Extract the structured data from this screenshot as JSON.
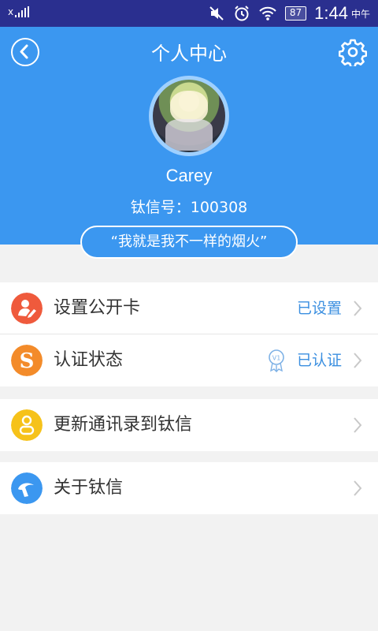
{
  "status_bar": {
    "network_label": "x",
    "battery": "87",
    "time": "1:44",
    "period": "中午"
  },
  "header": {
    "title": "个人中心",
    "username": "Carey",
    "user_id": "钛信号：100308",
    "signature": "“我就是我不一样的烟火”",
    "accent": "#3b97f0"
  },
  "menu": {
    "public_card": {
      "label": "设置公开卡",
      "value": "已设置",
      "icon": "person-card-icon",
      "color": "#ef5a3c"
    },
    "verify": {
      "label": "认证状态",
      "value": "已认证",
      "badge": "V1",
      "icon": "s-logo-icon",
      "color": "#f38b2a"
    },
    "contacts": {
      "label": "更新通讯录到钛信",
      "icon": "contact-person-icon",
      "color": "#f6c21a"
    },
    "about": {
      "label": "关于钛信",
      "icon": "app-logo-icon",
      "color": "#3b97f0"
    }
  }
}
